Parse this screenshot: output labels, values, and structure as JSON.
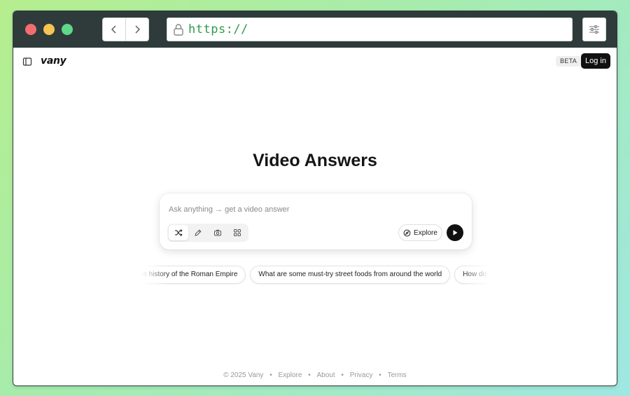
{
  "browser": {
    "url": "https://"
  },
  "app": {
    "brand": "vany",
    "badge": "BETA",
    "login_label": "Log in"
  },
  "main": {
    "title": "Video Answers",
    "search": {
      "placeholder": "Ask anything → get a video answer",
      "explore_label": "Explore",
      "tools": [
        {
          "icon": "shuffle-icon",
          "active": true
        },
        {
          "icon": "pen-icon",
          "active": false
        },
        {
          "icon": "camera-icon",
          "active": false
        },
        {
          "icon": "grid-icon",
          "active": false
        }
      ]
    },
    "suggestions": [
      "the history of the Roman Empire",
      "What are some must-try street foods from around the world",
      "How do speedru"
    ]
  },
  "footer": {
    "copyright": "© 2025 Vany",
    "links": [
      "Explore",
      "About",
      "Privacy",
      "Terms"
    ],
    "separator": "•"
  },
  "colors": {
    "accent_dark": "#111111",
    "url_green": "#2f9a4d",
    "chrome": "#2f3b3b"
  }
}
